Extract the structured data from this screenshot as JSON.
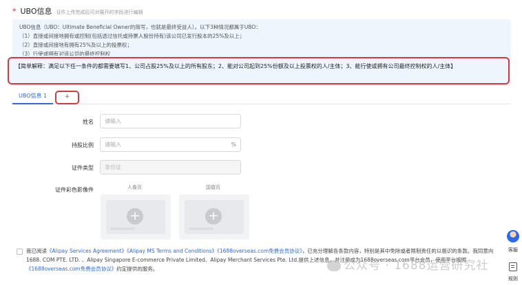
{
  "section": {
    "required_mark": "*",
    "title": "UBO信息",
    "subtitle": "证件上传完成后可对展开的字段进行编辑"
  },
  "info": {
    "line1": "UBO信息（UBO：Ultimate Beneficial Owner的简写，也就是最终受益人）。以下3种情况都属于UBO：",
    "line2": "（1）直接或间接地拥有或控制(包括透过信托或持票人股份持有)该公司已发行股本的25%及以上；",
    "line3": "（2）直接或间接地有拥有25%及以上的投票权；",
    "line4": "（3）行使或拥有对该公司的最终控制权",
    "explain": "【简单解释：满足以下任一条件的都需要填写1、公司占股25%及以上的所有股东；2、能对公司起到25%份额及以上投票权的人/主体；3、能行使或拥有公司最终控制权的人/主体】"
  },
  "tabs": {
    "active": "UBO信息 1",
    "add": "+"
  },
  "form": {
    "name_label": "姓名",
    "name_placeholder": "请输入",
    "share_label": "持股比例",
    "share_placeholder": "请输入",
    "share_suffix": "%",
    "idtype_label": "证件类型",
    "idtype_value": "身份证",
    "photo_label": "证件彩色影像件",
    "front_caption": "人像页",
    "back_caption": "国徽页",
    "upload_plus": "+"
  },
  "agreement": {
    "pre": "我已阅读",
    "link1": "《Alipay Services Agreement》",
    "link2": "《Alipay MS Terms and Conditions》",
    "link3": "《1688overseas.com免费会员协议》",
    "mid": "，已充分理解各条款内容，特别是其中免除或者限制责任的以粗识的条款。我同意向1688. COM PTE. LTD. 、Alipay Singapore E-commerce Private Limited、Alipay Merchant Services Pte. Ltd.提供上述信息，并注册成为1688overseas.com平台会员，使用平台按照",
    "link4": "《1688overseas.com免费会员协议》",
    "post": "约定提供的服务。"
  },
  "side": {
    "service_label": "客服",
    "rules_label": "规则",
    "service_icon": "customer-service-icon",
    "rules_icon": "rules-icon"
  },
  "watermark": {
    "text": "公众号 · 1688运营研究社"
  },
  "colors": {
    "accent": "#2a6ae9",
    "highlight_border": "#d9383a",
    "info_bg": "#eef5fd",
    "required": "#e02020"
  }
}
